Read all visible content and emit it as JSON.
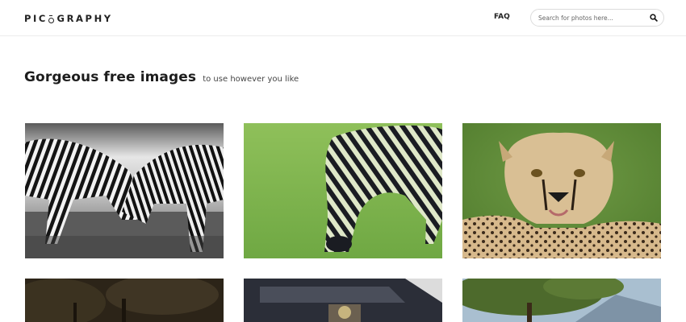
{
  "header": {
    "logo_start": "PIC",
    "logo_end": "GRAPHY",
    "nav": {
      "faq_label": "FAQ"
    },
    "search": {
      "placeholder": "Search for photos here...",
      "value": ""
    }
  },
  "hero": {
    "title": "Gorgeous free images",
    "subtitle": "to use however you like"
  },
  "icons": {
    "search": "search-icon",
    "logo_mark": "camera-lens-o-icon"
  },
  "photos": [
    {
      "subject": "zebras-fighting"
    },
    {
      "subject": "zebra-grazing"
    },
    {
      "subject": "cheetah-cub"
    },
    {
      "subject": "forest"
    },
    {
      "subject": "architecture"
    },
    {
      "subject": "tree-mountains"
    }
  ],
  "colors": {
    "text": "#1d1d1d",
    "border": "#dcdcdc",
    "background": "#ffffff"
  }
}
